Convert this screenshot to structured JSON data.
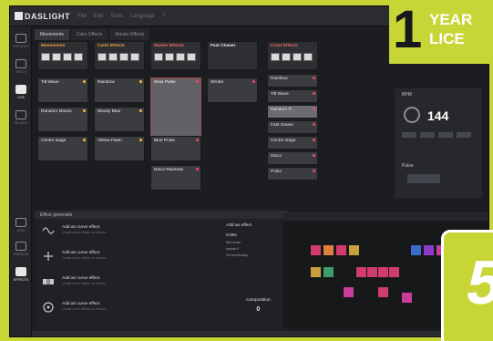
{
  "app": {
    "logo": "DASLIGHT",
    "menu": [
      "File",
      "Edit",
      "Tools",
      "Language",
      "?"
    ]
  },
  "sidebar": [
    {
      "label": "FIXTURES",
      "active": false
    },
    {
      "label": "PATCH",
      "active": false
    },
    {
      "label": "LIVE",
      "active": true
    },
    {
      "label": "3D VIEW",
      "active": false
    },
    {
      "label": "GRID",
      "active": false
    },
    {
      "label": "PRESETS",
      "active": false
    },
    {
      "label": "EFFECTS",
      "active": true
    }
  ],
  "tabs": [
    "Movements",
    "Color Effects",
    "Master Effects"
  ],
  "playbacks": {
    "col1": {
      "header": "Movements",
      "items": [
        "Tilt Wave",
        "Random Moves",
        "Centre stage"
      ]
    },
    "col2": {
      "header": "Color Effects",
      "items": [
        "Rainbow",
        "Moody Blue",
        "Yellow Flash"
      ]
    },
    "col3": {
      "header": "Master Effects",
      "items": [
        "Slow Pulse",
        "Blue Pulse",
        "Disco Rainbow"
      ]
    },
    "col4": {
      "header": "Fast Chaser",
      "items": [
        "Strobe"
      ]
    },
    "col5": {
      "header": "Color Effects",
      "items": [
        "Rainbow",
        "Tilt Wave",
        "Random P...",
        "Fast chaser",
        "Centre stage",
        "Disco",
        "Pulse"
      ]
    }
  },
  "bpm": {
    "label": "BPM",
    "value": "144"
  },
  "pulse": {
    "label": "Pulse"
  },
  "fx": {
    "header": "Effect generator",
    "items": [
      {
        "title": "Add an curve effect",
        "desc": "Create curve effects on fixtures"
      },
      {
        "title": "Add an curve effect",
        "desc": "Create curve effects on fixtures"
      },
      {
        "title": "Add an curve effect",
        "desc": "Create curve effects on fixtures"
      },
      {
        "title": "Add an curve effect",
        "desc": "Create curve effects on fixtures"
      }
    ],
    "side": {
      "title": "Add an effect",
      "time": "0:00s",
      "options": [
        "Non-cross",
        "Include 0",
        "On current step"
      ],
      "comp_label": "Composition",
      "comp_value": "0"
    }
  },
  "banner": {
    "number": "1",
    "line1": "YEAR",
    "line2": "LICE"
  },
  "badge": {
    "digit": "5"
  },
  "grid_colors": [
    "#d23c6c",
    "#e07e3c",
    "#c9a03e",
    "#3c9c6c",
    "#3c6cc9",
    "#8a3cc9",
    "#c93c9a"
  ]
}
